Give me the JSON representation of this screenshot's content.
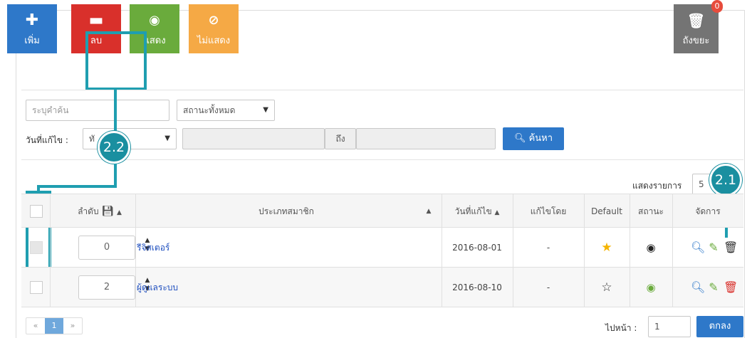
{
  "toolbar": {
    "add_label": "เพิ่ม",
    "delete_label": "ลบ",
    "show_label": "แสดง",
    "hide_label": "ไม่แสดง",
    "trash_label": "ถังขยะ",
    "trash_count": "0"
  },
  "filters": {
    "keyword_placeholder": "ระบุคำค้น",
    "status_select": "สถานะทั้งหมด",
    "date_label": "วันที่แก้ไข :",
    "date_select_partial": "ทั",
    "to_label": "ถึง",
    "search_button": "ค้นหา"
  },
  "callouts": {
    "delete": "2.2",
    "trash": "2.1"
  },
  "list": {
    "show_label": "แสดงรายการ",
    "show_count": "5"
  },
  "table": {
    "headers": {
      "order": "ลำดับ",
      "type": "ประเภทสมาชิก",
      "modified": "วันที่แก้ไข",
      "modified_by": "แก้ไขโดย",
      "default": "Default",
      "status": "สถานะ",
      "manage": "จัดการ"
    },
    "rows": [
      {
        "order": "0",
        "name": "รีจิสเตอร์",
        "date": "2016-08-01",
        "by": "-",
        "default": true
      },
      {
        "order": "2",
        "name": "ผู้ดูแลระบบ",
        "date": "2016-08-10",
        "by": "-",
        "default": false
      }
    ]
  },
  "footer": {
    "prev": "«",
    "page": "1",
    "next": "»",
    "goto_label": "ไปหน้า :",
    "goto_value": "1",
    "ok_button": "ตกลง"
  },
  "colors": {
    "add": "#2e78c9",
    "delete": "#d9302b",
    "show": "#6aab3c",
    "hide": "#f5a945",
    "trash": "#747474",
    "callout": "#1a8fa0"
  }
}
